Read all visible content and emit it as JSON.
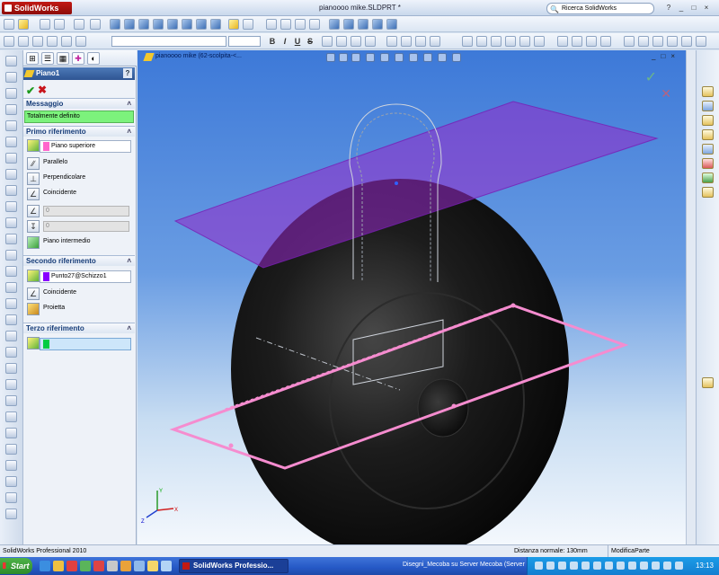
{
  "app": {
    "logo_text": "SolidWorks",
    "title": "pianoooo mike.SLDPRT *",
    "search_placeholder": "Ricerca SolidWorks",
    "window_controls": [
      "_",
      "□",
      "×"
    ]
  },
  "property_manager": {
    "title": "Piano1",
    "help": "?",
    "ok": "✔",
    "cancel": "✖",
    "message_group": {
      "label": "Messaggio",
      "text": "Totalmente definito",
      "status_color": "#7cf27c"
    },
    "first_reference": {
      "label": "Primo riferimento",
      "selection": "Piano superiore",
      "selection_color": "#ff66cc",
      "options": [
        "Parallelo",
        "Perpendicolare",
        "Coincidente"
      ],
      "angle_value": "0",
      "offset_value": "0",
      "mid_plane": "Piano intermedio"
    },
    "second_reference": {
      "label": "Secondo riferimento",
      "selection": "Punto27@Schizzo1",
      "selection_color": "#8800ff",
      "options": [
        "Coincidente",
        "Proietta"
      ]
    },
    "third_reference": {
      "label": "Terzo riferimento",
      "selection": "",
      "selection_color": "#00cc44"
    }
  },
  "viewport": {
    "doc_label": "pianoooo mike  (62-scolpita-<...",
    "controls": [
      "_",
      "□",
      "×"
    ],
    "confirm_ok": "✓",
    "confirm_cancel": "✕",
    "triad_axes": [
      "X",
      "Y",
      "Z"
    ]
  },
  "status_bar": {
    "left": "SolidWorks Professional 2010",
    "distance": "Distanza normale: 130mm",
    "mode": "ModificaParte"
  },
  "taskbar": {
    "start": "Start",
    "active_task": "SolidWorks Professio...",
    "other_task": "Disegni_Mecoba su Server Mecoba (Server",
    "clock": "13:13"
  }
}
